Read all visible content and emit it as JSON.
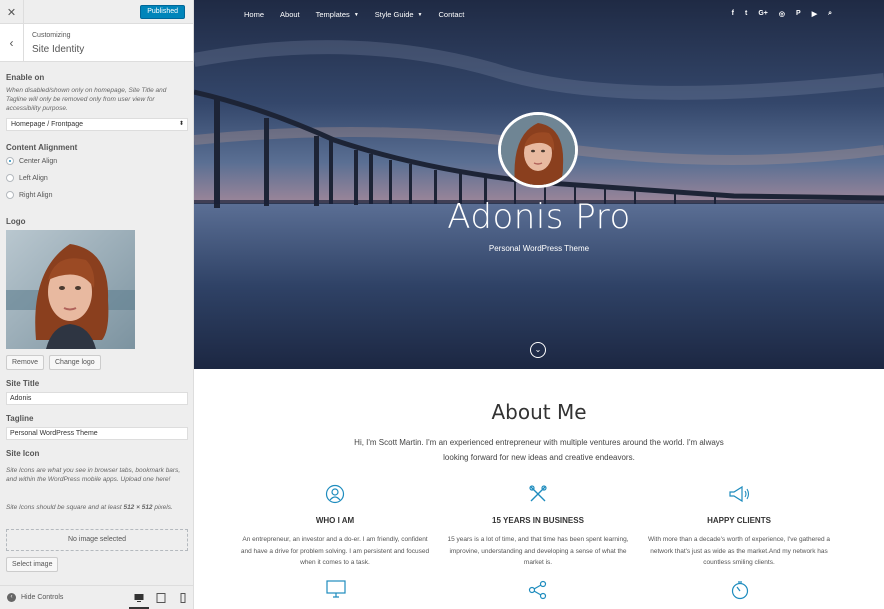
{
  "customizer": {
    "publish_label": "Published",
    "breadcrumb": "Customizing",
    "section_title": "Site Identity",
    "enable_on": {
      "label": "Enable on",
      "description": "When disabled/shown only on homepage, Site Title and Tagline will only be removed only from user view for accessibility purpose.",
      "selected": "Homepage / Frontpage"
    },
    "content_alignment": {
      "label": "Content Alignment",
      "options": [
        "Center Align",
        "Left Align",
        "Right Align"
      ],
      "selected": "Center Align"
    },
    "logo": {
      "label": "Logo",
      "remove_label": "Remove",
      "change_label": "Change logo"
    },
    "site_title": {
      "label": "Site Title",
      "value": "Adonis"
    },
    "tagline": {
      "label": "Tagline",
      "value": "Personal WordPress Theme"
    },
    "site_icon": {
      "label": "Site Icon",
      "description1": "Site Icons are what you see in browser tabs, bookmark bars, and within the WordPress mobile apps. Upload one here!",
      "description2_pre": "Site Icons should be square and at least ",
      "description2_size": "512 × 512",
      "description2_post": " pixels.",
      "no_image": "No image selected",
      "select_label": "Select image"
    },
    "footer": {
      "hide_controls": "Hide Controls"
    }
  },
  "preview": {
    "nav": [
      "Home",
      "About",
      "Templates",
      "Style Guide",
      "Contact"
    ],
    "social_icons": [
      "facebook-icon",
      "twitter-icon",
      "google-plus-icon",
      "dribbble-icon",
      "pinterest-icon",
      "youtube-icon",
      "search-icon"
    ],
    "social_glyphs": [
      "f",
      "t",
      "G+",
      "◎",
      "P",
      "▶",
      "⌕"
    ],
    "hero": {
      "title": "Adonis Pro",
      "subtitle": "Personal WordPress Theme"
    },
    "about": {
      "title": "About Me",
      "text": "Hi, I'm Scott Martin. I'm an experienced entrepreneur with multiple ventures around the world. I'm always looking forward for new ideas and creative endeavors.",
      "features": [
        {
          "icon": "user-icon",
          "title": "WHO I AM",
          "text": "An entrepreneur, an investor and a do-er. I am friendly, confident and have a drive for problem solving. I am persistent and focused when it comes to a task."
        },
        {
          "icon": "tools-icon",
          "title": "15 YEARS IN BUSINESS",
          "text": "15 years is a lot of time, and that time has been spent learning, improvine, understanding and developing a sense of what the market is."
        },
        {
          "icon": "megaphone-icon",
          "title": "HAPPY CLIENTS",
          "text": "With more than a decade's worth of experience, I've gathered a network that's just as wide as the market.And my network has countless smiling clients."
        }
      ]
    },
    "accent_color": "#1e8cbe"
  }
}
